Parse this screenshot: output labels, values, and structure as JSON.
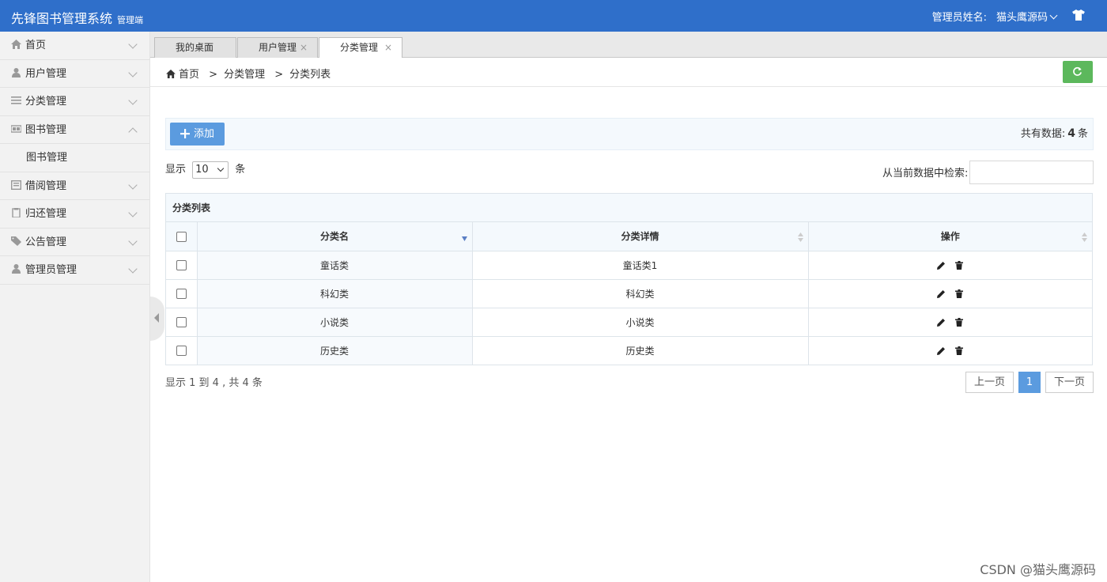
{
  "header": {
    "title": "先锋图书管理系统",
    "subtitle": "管理端",
    "admin_label": "管理员姓名:",
    "admin_name": "猫头鹰源码"
  },
  "sidebar": {
    "items": [
      {
        "label": "首页",
        "icon": "home-icon"
      },
      {
        "label": "用户管理",
        "icon": "user-icon"
      },
      {
        "label": "分类管理",
        "icon": "list-icon"
      },
      {
        "label": "图书管理",
        "icon": "book-icon",
        "expanded": true
      },
      {
        "label": "借阅管理",
        "icon": "borrow-icon"
      },
      {
        "label": "归还管理",
        "icon": "return-icon"
      },
      {
        "label": "公告管理",
        "icon": "tag-icon"
      },
      {
        "label": "管理员管理",
        "icon": "admin-icon"
      }
    ],
    "sub_items": [
      "图书管理"
    ]
  },
  "tabs": [
    {
      "label": "我的桌面",
      "closable": false
    },
    {
      "label": "用户管理",
      "closable": true
    },
    {
      "label": "分类管理",
      "closable": true,
      "active": true
    }
  ],
  "tab_close": "×",
  "breadcrumb": {
    "home": "首页",
    "sep": ">",
    "level1": "分类管理",
    "level2": "分类列表"
  },
  "toolbar": {
    "add_label": "添加",
    "total_prefix": "共有数据:",
    "total_count": "4",
    "total_suffix": "条"
  },
  "length": {
    "prefix": "显示",
    "value": "10",
    "suffix": "条"
  },
  "search": {
    "label": "从当前数据中检索:",
    "value": ""
  },
  "table": {
    "caption": "分类列表",
    "headers": [
      "分类名",
      "分类详情",
      "操作"
    ],
    "rows": [
      {
        "name": "童话类",
        "detail": "童话类1"
      },
      {
        "name": "科幻类",
        "detail": "科幻类"
      },
      {
        "name": "小说类",
        "detail": "小说类"
      },
      {
        "name": "历史类",
        "detail": "历史类"
      }
    ]
  },
  "footer": {
    "info": "显示 1 到 4 ,  共 4 条",
    "prev": "上一页",
    "current": "1",
    "next": "下一页"
  },
  "watermark": "CSDN @猫头鹰源码",
  "colors": {
    "header": "#2f6fca",
    "add_button": "#5b9bdf",
    "refresh_button": "#5cb85c"
  }
}
